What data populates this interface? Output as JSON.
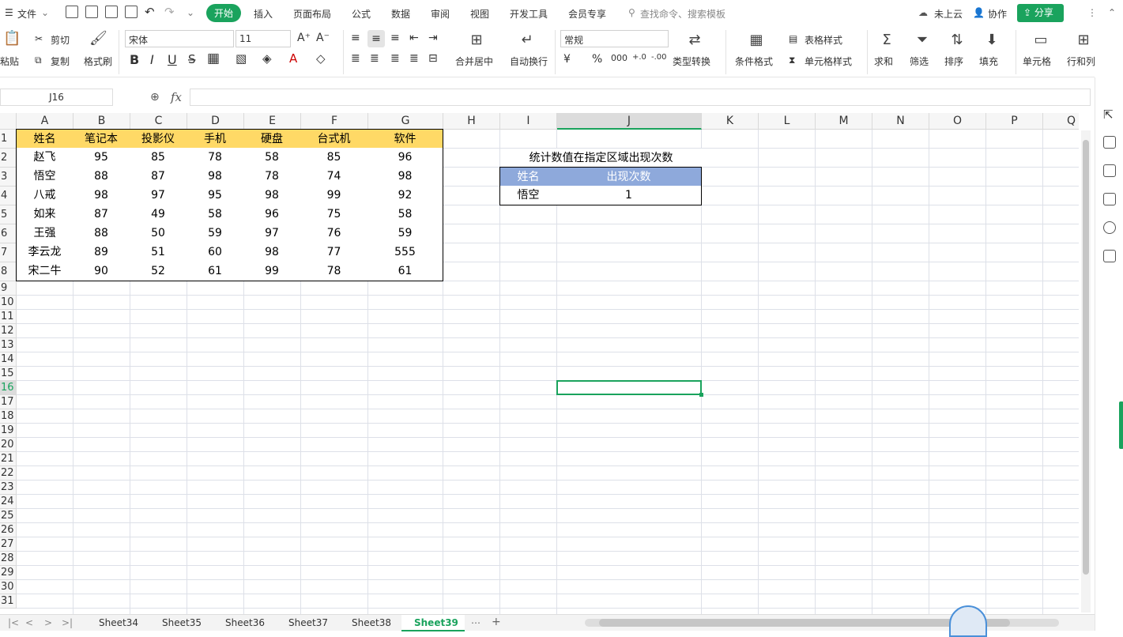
{
  "menubar": {
    "file": "文件",
    "tabs": [
      "开始",
      "插入",
      "页面布局",
      "公式",
      "数据",
      "审阅",
      "视图",
      "开发工具",
      "会员专享"
    ],
    "search_placeholder": "查找命令、搜索模板",
    "cloud": "未上云",
    "collab": "协作",
    "share": "分享"
  },
  "ribbon": {
    "paste": "粘贴",
    "cut": "剪切",
    "copy": "复制",
    "format_painter": "格式刷",
    "font_name": "宋体",
    "font_size": "11",
    "merge_center": "合并居中",
    "wrap_text": "自动换行",
    "number_format": "常规",
    "type_convert": "类型转换",
    "conditional_format": "条件格式",
    "table_style": "表格样式",
    "cell_style": "单元格样式",
    "sum": "求和",
    "filter": "筛选",
    "sort": "排序",
    "fill": "填充",
    "cells": "单元格",
    "rows_cols": "行和列"
  },
  "formula": {
    "name_box": "J16",
    "fx": "fx",
    "value": ""
  },
  "columns": [
    "A",
    "B",
    "C",
    "D",
    "E",
    "F",
    "G",
    "H",
    "I",
    "J",
    "K",
    "L",
    "M",
    "N",
    "O",
    "P",
    "Q"
  ],
  "rows": [
    "1",
    "2",
    "3",
    "4",
    "5",
    "6",
    "7",
    "8",
    "9",
    "10",
    "11",
    "12",
    "13",
    "14",
    "15",
    "16",
    "17",
    "18",
    "19",
    "20",
    "21",
    "22",
    "23",
    "24",
    "25",
    "26",
    "27",
    "28",
    "29",
    "30",
    "31"
  ],
  "table": {
    "headers": [
      "姓名",
      "笔记本",
      "投影仪",
      "手机",
      "硬盘",
      "台式机",
      "软件"
    ],
    "rows": [
      [
        "赵飞",
        "95",
        "85",
        "78",
        "58",
        "85",
        "96"
      ],
      [
        "悟空",
        "88",
        "87",
        "98",
        "78",
        "74",
        "98"
      ],
      [
        "八戒",
        "98",
        "97",
        "95",
        "98",
        "99",
        "92"
      ],
      [
        "如来",
        "87",
        "49",
        "58",
        "96",
        "75",
        "58"
      ],
      [
        "王强",
        "88",
        "50",
        "59",
        "97",
        "76",
        "59"
      ],
      [
        "李云龙",
        "89",
        "51",
        "60",
        "98",
        "77",
        "555"
      ],
      [
        "宋二牛",
        "90",
        "52",
        "61",
        "99",
        "78",
        "61"
      ]
    ],
    "header_color": "#ffd966"
  },
  "stats": {
    "title": "统计数值在指定区域出现次数",
    "headers": [
      "姓名",
      "出现次数"
    ],
    "row": [
      "悟空",
      "1"
    ],
    "header_color": "#8ea9db"
  },
  "sheet_tabs": [
    "Sheet34",
    "Sheet35",
    "Sheet36",
    "Sheet37",
    "Sheet38",
    "Sheet39"
  ],
  "active_sheet": "Sheet39",
  "accent": "#1aa35d"
}
